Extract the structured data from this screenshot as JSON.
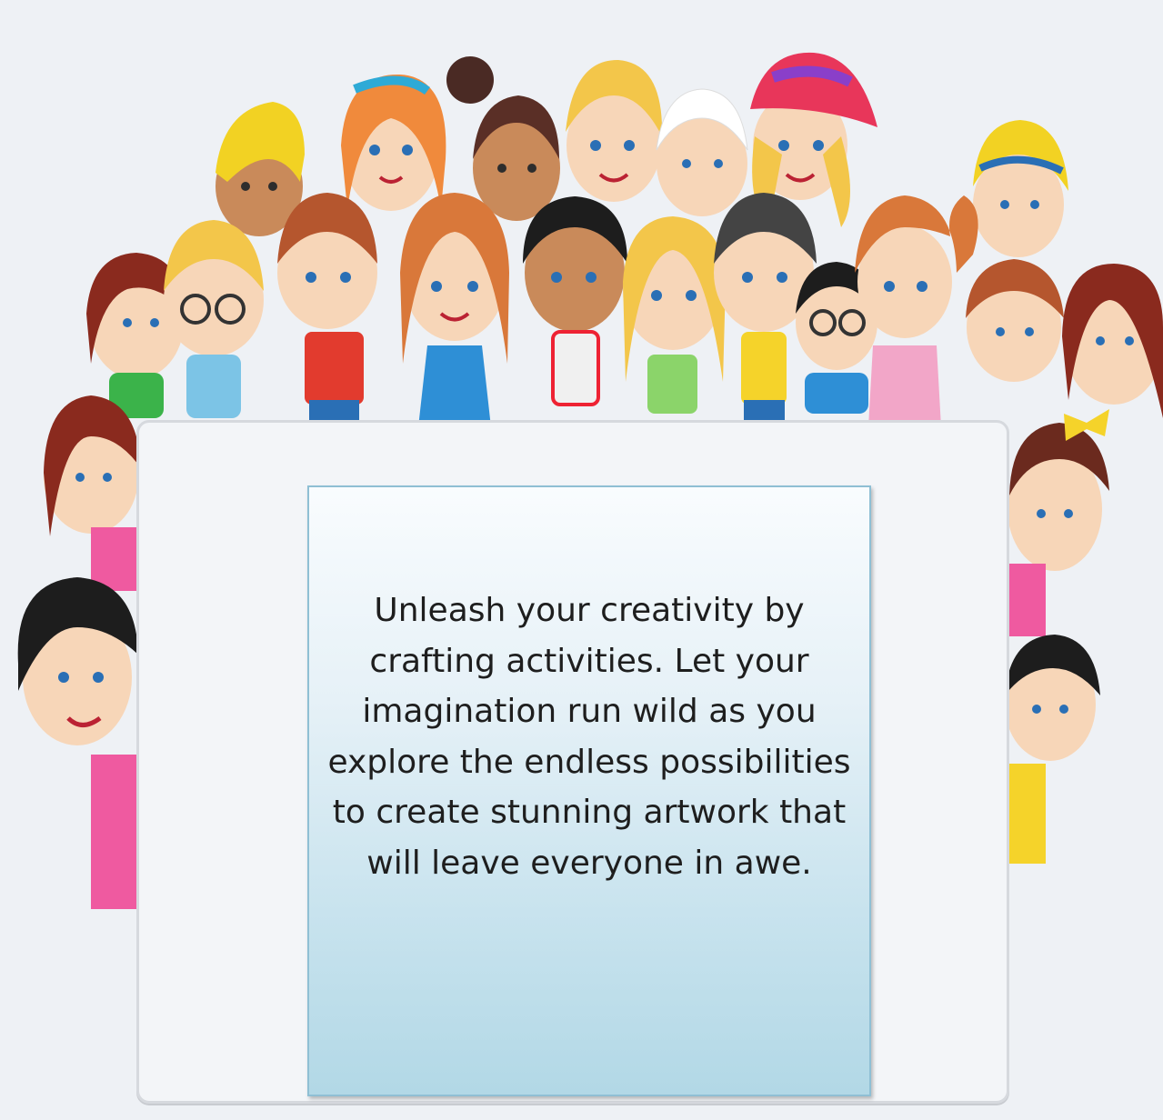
{
  "card": {
    "message": "Unleash your creativity by crafting activities. Let your imagination run wild as you explore the endless possibilities to create stunning artwork that will leave everyone in awe."
  },
  "illustration": {
    "icon": "group-of-kids-illustration"
  }
}
